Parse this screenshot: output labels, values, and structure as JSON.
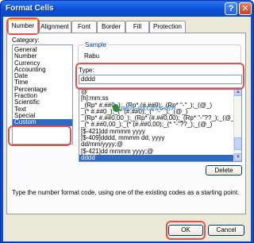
{
  "window": {
    "title": "Format Cells",
    "help_glyph": "?",
    "close_glyph": "✕"
  },
  "tabs": [
    "Number",
    "Alignment",
    "Font",
    "Border",
    "Fill",
    "Protection"
  ],
  "category": {
    "label": "Category:",
    "items": [
      "General",
      "Number",
      "Currency",
      "Accounting",
      "Date",
      "Time",
      "Percentage",
      "Fraction",
      "Scientific",
      "Text",
      "Special",
      "Custom"
    ],
    "selected": "Custom"
  },
  "sample": {
    "label": "Sample",
    "value": "Rabu"
  },
  "type": {
    "label": "Type:",
    "value": "dddd",
    "items": [
      "@",
      "[h]:mm:ss",
      "_(Rp* #.##0_);_(Rp* (#.##0);_(Rp* \"-\"_);_(@_)",
      "_(* #.##0_);_(* (#.##0);_(* \"-\"_);_(@_)",
      "_(Rp* #.##0,00_);_(Rp* (#.##0,00);_(Rp* \"-\"??_);_(@_)",
      "_(* #.##0,00_);_(* (#.##0,00);_(* \"-\"??_);_(@_)",
      "[$-421]dd mmmm yyyy",
      "[$-409]dddd, mmmm dd, yyyy",
      "dd/mm/yyyy;@",
      "[$-421]dd mmmm yyyy;@",
      "dddd"
    ],
    "selected": "dddd"
  },
  "delete_label": "Delete",
  "hint": "Type the number format code, using one of the existing codes as a starting point.",
  "ok_label": "OK",
  "cancel_label": "Cancel",
  "watermark": "adh-excel.com",
  "colors": {
    "titlebar": "#0b52d8",
    "selection": "#316ac5",
    "highlight_box": "#e0524a"
  }
}
